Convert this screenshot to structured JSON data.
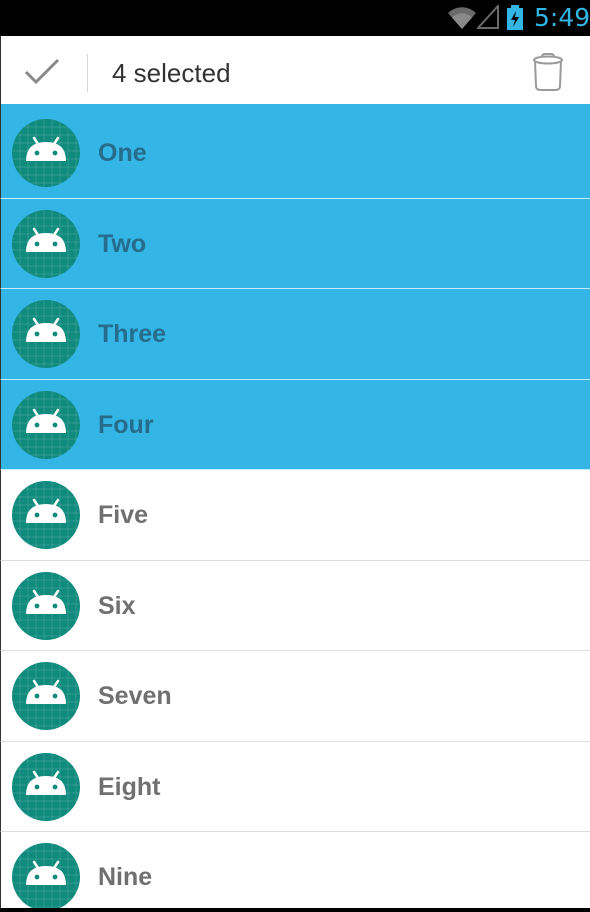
{
  "status_bar": {
    "time": "5:49"
  },
  "action_mode": {
    "title": "4 selected",
    "done_icon": "checkmark-icon",
    "delete_icon": "trash-icon"
  },
  "list": {
    "items": [
      {
        "label": "One",
        "selected": true
      },
      {
        "label": "Two",
        "selected": true
      },
      {
        "label": "Three",
        "selected": true
      },
      {
        "label": "Four",
        "selected": true
      },
      {
        "label": "Five",
        "selected": false
      },
      {
        "label": "Six",
        "selected": false
      },
      {
        "label": "Seven",
        "selected": false
      },
      {
        "label": "Eight",
        "selected": false
      },
      {
        "label": "Nine",
        "selected": false
      }
    ]
  },
  "colors": {
    "accent": "#33b5e5",
    "avatar": "#0f8a7d",
    "selected_text": "#276c8a",
    "text": "#707070"
  }
}
